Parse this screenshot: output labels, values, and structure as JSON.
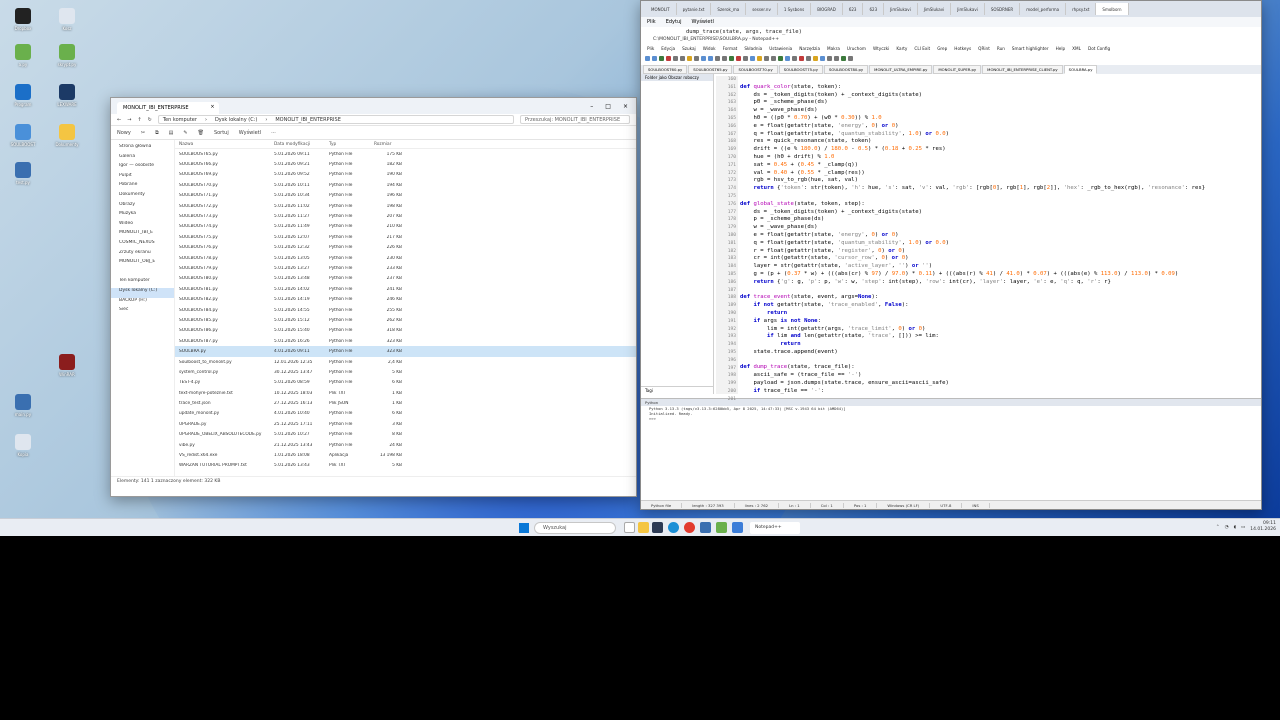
{
  "desktop": {
    "icons": [
      {
        "label": "Dropbox"
      },
      {
        "label": "Kosz"
      },
      {
        "label": "a.py"
      },
      {
        "label": "skrypt.py"
      },
      {
        "label": "Program"
      },
      {
        "label": "LEXWARE"
      },
      {
        "label": "SOULBOOST"
      },
      {
        "label": "Dokumenty"
      },
      {
        "label": "WinRAR"
      },
      {
        "label": "test.py"
      },
      {
        "label": "main.py"
      },
      {
        "label": "Kopia"
      }
    ]
  },
  "explorer": {
    "tab_title": "MONOLIT_IBI_ENTERPRISE",
    "path": [
      "Ten komputer",
      "Dysk lokalny (C:)",
      "MONOLIT_IBI_ENTERPRISE"
    ],
    "search_placeholder": "Przeszukaj: MONOLIT_IBI_ENTERPRISE",
    "new_label": "Nowy",
    "sort_label": "Sortuj",
    "view_label": "Wyświetl",
    "nav": [
      "Strona główna",
      "Galeria",
      "Igor — osobiste",
      "Pulpit",
      "Pobrane",
      "Dokumenty",
      "Obrazy",
      "Muzyka",
      "Wideo",
      "MONOLIT_IBI_E",
      "COSMIC_NEXUS",
      "Zrzuty ekranu",
      "MONOLIT_OBJ_E",
      "",
      "Ten komputer",
      "Dysk lokalny (C:)",
      "BACKUP (H:)",
      "Sieć"
    ],
    "columns": [
      "Nazwa",
      "Data modyfikacji",
      "Typ",
      "Rozmiar"
    ],
    "files": [
      {
        "name": "SOULBOOST65.py",
        "date": "5.01.2026 09:11",
        "type": "Python File",
        "size": "175 KB"
      },
      {
        "name": "SOULBOOST66.py",
        "date": "5.01.2026 09:21",
        "type": "Python File",
        "size": "182 KB"
      },
      {
        "name": "SOULBOOST69.py",
        "date": "5.01.2026 09:52",
        "type": "Python File",
        "size": "190 KB"
      },
      {
        "name": "SOULBOOST70.py",
        "date": "5.01.2026 10:11",
        "type": "Python File",
        "size": "194 KB"
      },
      {
        "name": "SOULBOOST71.py",
        "date": "5.01.2026 10:34",
        "type": "Python File",
        "size": "196 KB"
      },
      {
        "name": "SOULBOOST72.py",
        "date": "5.01.2026 11:02",
        "type": "Python File",
        "size": "198 KB"
      },
      {
        "name": "SOULBOOST73.py",
        "date": "5.01.2026 11:27",
        "type": "Python File",
        "size": "207 KB"
      },
      {
        "name": "SOULBOOST74.py",
        "date": "5.01.2026 11:49",
        "type": "Python File",
        "size": "210 KB"
      },
      {
        "name": "SOULBOOST75.py",
        "date": "5.01.2026 12:07",
        "type": "Python File",
        "size": "217 KB"
      },
      {
        "name": "SOULBOOST76.py",
        "date": "5.01.2026 12:32",
        "type": "Python File",
        "size": "226 KB"
      },
      {
        "name": "SOULBOOST78.py",
        "date": "5.01.2026 13:05",
        "type": "Python File",
        "size": "230 KB"
      },
      {
        "name": "SOULBOOST79.py",
        "date": "5.01.2026 13:27",
        "type": "Python File",
        "size": "233 KB"
      },
      {
        "name": "SOULBOOST80.py",
        "date": "5.01.2026 13:48",
        "type": "Python File",
        "size": "237 KB"
      },
      {
        "name": "SOULBOOST81.py",
        "date": "5.01.2026 14:02",
        "type": "Python File",
        "size": "241 KB"
      },
      {
        "name": "SOULBOOST82.py",
        "date": "5.01.2026 14:19",
        "type": "Python File",
        "size": "246 KB"
      },
      {
        "name": "SOULBOOST84.py",
        "date": "5.01.2026 14:55",
        "type": "Python File",
        "size": "255 KB"
      },
      {
        "name": "SOULBOOST85.py",
        "date": "5.01.2026 15:12",
        "type": "Python File",
        "size": "262 KB"
      },
      {
        "name": "SOULBOOST86.py",
        "date": "5.01.2026 15:40",
        "type": "Python File",
        "size": "318 KB"
      },
      {
        "name": "SOULBOOST87.py",
        "date": "5.01.2026 16:26",
        "type": "Python File",
        "size": "323 KB"
      },
      {
        "name": "SOULBRA.py",
        "date": "4.01.2026 09:11",
        "type": "Python File",
        "size": "323 KB",
        "selected": true
      },
      {
        "name": "Soulboost_to_monolit.py",
        "date": "12.01.2026 12:35",
        "type": "Python File",
        "size": "2,4 KB"
      },
      {
        "name": "system_control.py",
        "date": "30.12.2025 13:47",
        "type": "Python File",
        "size": "5 KB"
      },
      {
        "name": "TEST-4.py",
        "date": "5.01.2026 08:59",
        "type": "Python File",
        "size": "6 KB"
      },
      {
        "name": "text-mohyre-poteznie.txt",
        "date": "10.12.2025 18:03",
        "type": "Plik TXT",
        "size": "1 KB"
      },
      {
        "name": "trace_test.json",
        "date": "27.12.2025 16:13",
        "type": "Plik JSON",
        "size": "1 KB"
      },
      {
        "name": "update_monolit.py",
        "date": "4.01.2026 10:40",
        "type": "Python File",
        "size": "6 KB"
      },
      {
        "name": "UPGRADE.py",
        "date": "25.12.2025 17:11",
        "type": "Python File",
        "size": "3 KB"
      },
      {
        "name": "UPGRADE_OBELIX_ABSOLUTECODE.py",
        "date": "5.01.2026 10:27",
        "type": "Python File",
        "size": "8 KB"
      },
      {
        "name": "vibe.py",
        "date": "21.12.2025 13:43",
        "type": "Python File",
        "size": "24 KB"
      },
      {
        "name": "VS_redist.x64.exe",
        "date": "1.01.2026 18:08",
        "type": "Aplikacja",
        "size": "13 198 KB"
      },
      {
        "name": "WARZAN TUTORIAL PROMPT.txt",
        "date": "5.01.2026 13:43",
        "type": "Plik TXT",
        "size": "5 KB"
      }
    ],
    "status": "Elementy: 141    1 zaznaczony element: 322 KB"
  },
  "browser": {
    "tabs": [
      "MONOLIT",
      "pytanie.txt",
      "Szerok_ma",
      "sesser.nv",
      "1 Sysbons",
      "BIOGRAD",
      "623",
      "623",
      "JimSlukavi",
      "JimSlukavi",
      "JimSlukavi",
      "SOSDRNER",
      "model_performa",
      "rhpsy.txt",
      "Smolborn"
    ],
    "menu": [
      "Plik",
      "Edytuj",
      "Wyświetl"
    ]
  },
  "npp": {
    "tooltip": "dump_trace(state, args, trace_file)",
    "title": "C:\\MONOLIT_IBI_ENTERPRISE\\SOULBRA.py - Notepad++",
    "menu": [
      "Plik",
      "Edycja",
      "Szukaj",
      "Widok",
      "Format",
      "Składnia",
      "Ustawienia",
      "Narzędzia",
      "Makra",
      "Uruchom",
      "Wtyczki",
      "Karty",
      "CLI Exit",
      "Grep",
      "Hotkeys",
      "QRint",
      "Run",
      "Smart highlighter",
      "Help",
      "XML",
      "Dot Config"
    ],
    "file_tabs": [
      "SOULBOOST60.py",
      "SOULBOOST65.py",
      "SOULBOOST70.py",
      "SOULBOOST75.py",
      "SOULBOOST80.py",
      "MONOLIT_ULTRA_EMPIRE.py",
      "MONOLIT_SUPER.py",
      "MONOLIT_IBI_ENTERPRISE_CLIENT.py",
      "SOULBRA.py"
    ],
    "panel_title": "Folder jako Obszar roboczy",
    "panel_footer": "Tagi",
    "line_numbers": [
      "160",
      "161",
      "162",
      "163",
      "164",
      "165",
      "166",
      "167",
      "168",
      "169",
      "170",
      "171",
      "172",
      "173",
      "174",
      "175",
      "176",
      "177",
      "178",
      "179",
      "180",
      "181",
      "182",
      "183",
      "184",
      "185",
      "186",
      "187",
      "188",
      "189",
      "190",
      "191",
      "192",
      "193",
      "194",
      "195",
      "196",
      "197",
      "198",
      "199",
      "200",
      "201"
    ],
    "code": [
      "",
      "def quark_color(state, token):",
      "    ds = _token_digits(token) + _context_digits(state)",
      "    p0 = _scheme_phase(ds)",
      "    w = _wave_phase(ds)",
      "    h0 = ((p0 * 0.70) + (w0 * 0.30)) % 1.0",
      "    e = float(getattr(state, 'energy', 0) or 0)",
      "    q = float(getattr(state, 'quantum_stability', 1.0) or 0.0)",
      "    res = quick_resonance(state, token)",
      "    drift = ((e % 180.0) / 180.0 - 0.5) * (0.18 + 0.25 * res)",
      "    hue = (h0 + drift) % 1.0",
      "    sat = 0.45 + (0.45 * _clamp(q))",
      "    val = 0.40 + (0.55 * _clamp(res))",
      "    rgb = hsv_to_rgb(hue, sat, val)",
      "    return {'token': str(token), 'h': hue, 's': sat, 'v': val, 'rgb': [rgb[0], rgb[1], rgb[2]], 'hex': _rgb_to_hex(rgb), 'resonance': res}",
      "",
      "def global_state(state, token, step):",
      "    ds = _token_digits(token) + _context_digits(state)",
      "    p = _scheme_phase(ds)",
      "    w = _wave_phase(ds)",
      "    e = float(getattr(state, 'energy', 0) or 0)",
      "    q = float(getattr(state, 'quantum_stability', 1.0) or 0.0)",
      "    r = float(getattr(state, 'register', 0) or 0)",
      "    cr = int(getattr(state, 'cursor_row', 0) or 0)",
      "    layer = str(getattr(state, 'active_layer', '') or '')",
      "    g = (p + (0.37 * w) + (((abs(cr) % 97) / 97.0) * 0.11) + (((abs(r) % 41) / 41.0) * 0.07) + (((abs(e) % 113.0) / 113.0) * 0.09)",
      "    return {'g': g, 'p': p, 'w': w, 'step': int(step), 'row': int(cr), 'layer': layer, 'e': e, 'q': q, 'r': r}",
      "",
      "def trace_event(state, event, args=None):",
      "    if not getattr(state, 'trace_enabled', False):",
      "        return",
      "    if args is not None:",
      "        lim = int(getattr(args, 'trace_limit', 0) or 0)",
      "        if lim and len(getattr(state, 'trace', [])) >= lim:",
      "            return",
      "    state.trace.append(event)",
      "",
      "def dump_trace(state, trace_file):",
      "    ascii_safe = (trace_file == '-')",
      "    payload = json.dumps(state.trace, ensure_ascii=ascii_safe)",
      "    if trace_file == '-':",
      ""
    ],
    "console_title": "Python",
    "console_lines": [
      "Python 3.13.3 (tags/v3.13.3:6280bb5, Apr  8 2025, 14:47:33) [MSC v.1943 64 bit (AMD64)]",
      "Initialized. Ready.",
      "",
      ">>> "
    ],
    "status": [
      "Python file",
      "length : 327 393",
      "lines : 2 762",
      "Ln : 1",
      "Col : 1",
      "Pos : 1",
      "Windows (CR LF)",
      "UTF-8",
      "INS"
    ]
  },
  "taskbar": {
    "search_placeholder": "Wyszukaj",
    "active_file": "Notepad++",
    "time": "09:11",
    "date": "14.01.2026"
  },
  "colors": {
    "accent": "#0a78d7",
    "keyword": "#0000cc",
    "function": "#b400b4",
    "string": "#808080"
  }
}
